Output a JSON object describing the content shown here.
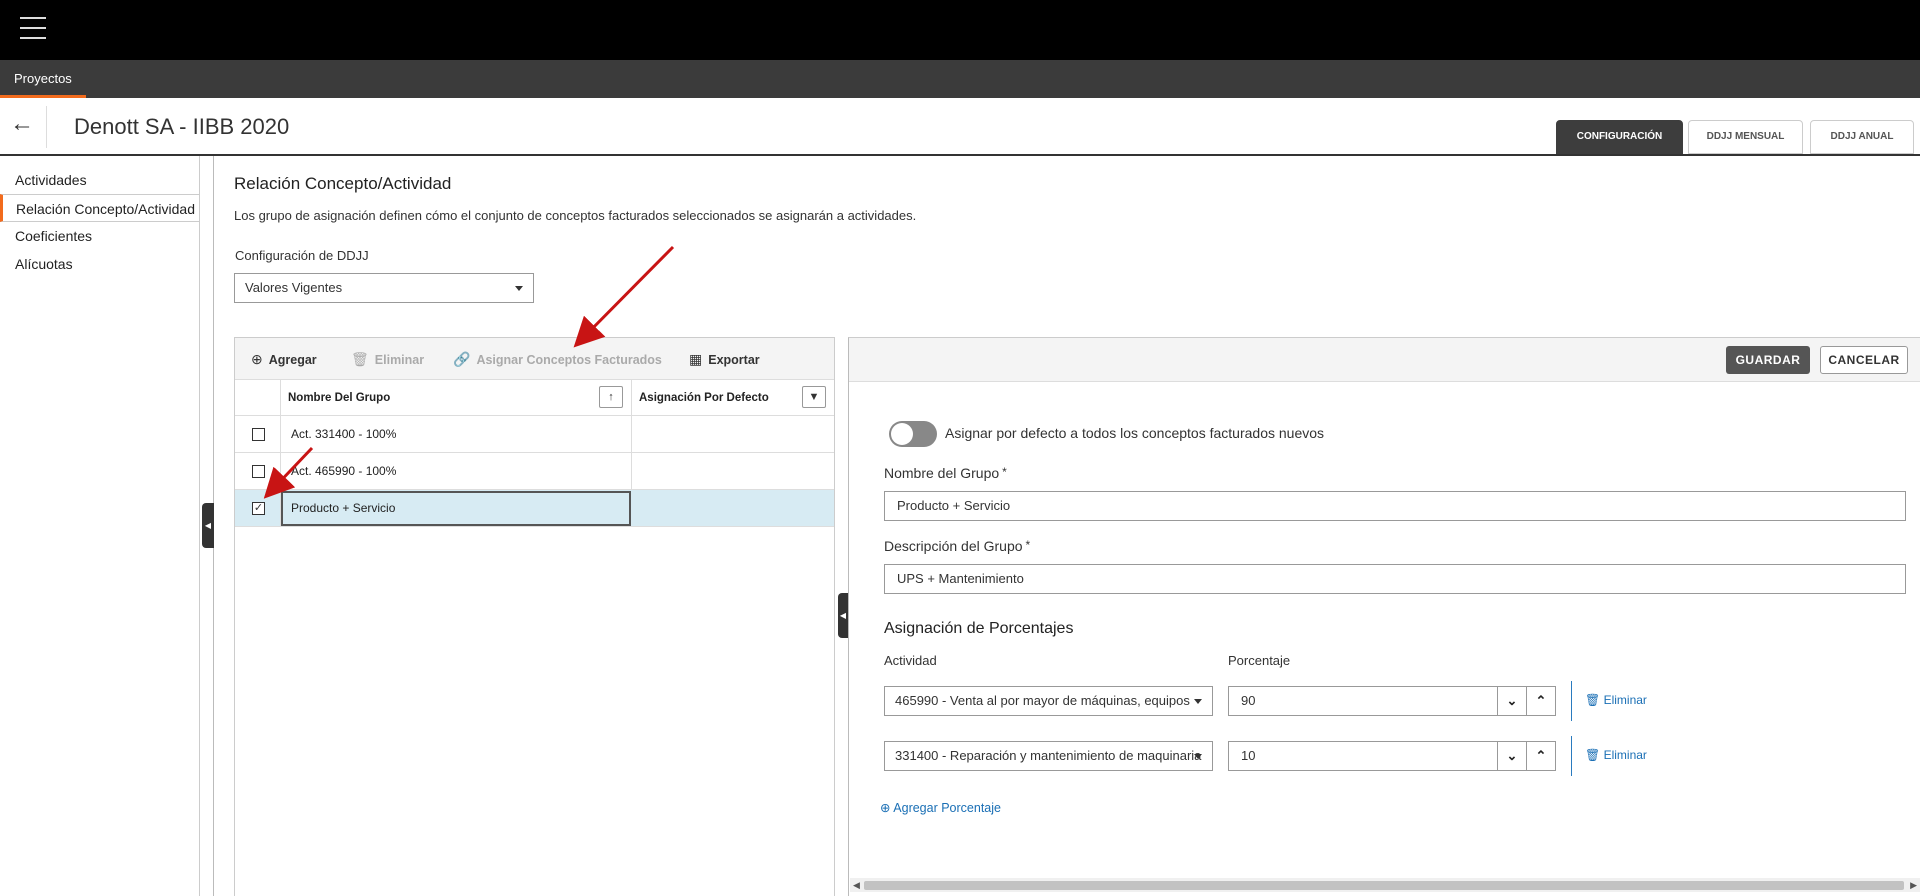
{
  "nav": {
    "menu_icon": "hamburger-icon",
    "tab": "Proyectos",
    "accent": "#f26b1d"
  },
  "header": {
    "back_icon": "arrow-left-icon",
    "title": "Denott SA - IIBB 2020",
    "tabs": [
      "CONFIGURACIÓN",
      "DDJJ MENSUAL",
      "DDJJ ANUAL"
    ]
  },
  "sidebar": {
    "items": [
      "Actividades",
      "Relación Concepto/Actividad",
      "Coeficientes",
      "Alícuotas"
    ]
  },
  "section": {
    "title": "Relación Concepto/Actividad",
    "description": "Los grupo de asignación definen cómo el conjunto de conceptos facturados seleccionados se asignarán a actividades.",
    "config_label": "Configuración de DDJJ",
    "config_value": "Valores Vigentes"
  },
  "toolbar": {
    "add": "Agregar",
    "delete": "Eliminar",
    "assign": "Asignar Conceptos Facturados",
    "export": "Exportar"
  },
  "grid": {
    "headers": [
      "Nombre Del Grupo",
      "Asignación Por Defecto"
    ],
    "rows": [
      {
        "name": "Act. 331400 - 100%",
        "checked": false
      },
      {
        "name": "Act. 465990 - 100%",
        "checked": false
      },
      {
        "name": "Producto + Servicio",
        "checked": true
      }
    ]
  },
  "form": {
    "save": "GUARDAR",
    "cancel": "CANCELAR",
    "toggle_label": "Asignar por defecto a todos los conceptos facturados nuevos",
    "group_name_label": "Nombre del Grupo",
    "group_name_value": "Producto + Servicio",
    "group_desc_label": "Descripción del Grupo",
    "group_desc_value": "UPS + Mantenimiento",
    "required_mark": "*",
    "percent_title": "Asignación de Porcentajes",
    "col_activity": "Actividad",
    "col_percent": "Porcentaje",
    "rows": [
      {
        "activity": "465990 - Venta al por mayor de máquinas, equipos",
        "percent": "90",
        "delete": "Eliminar"
      },
      {
        "activity": "331400 - Reparación y mantenimiento de maquinaria",
        "percent": "10",
        "delete": "Eliminar"
      }
    ],
    "add_percent": "Agregar Porcentaje"
  }
}
